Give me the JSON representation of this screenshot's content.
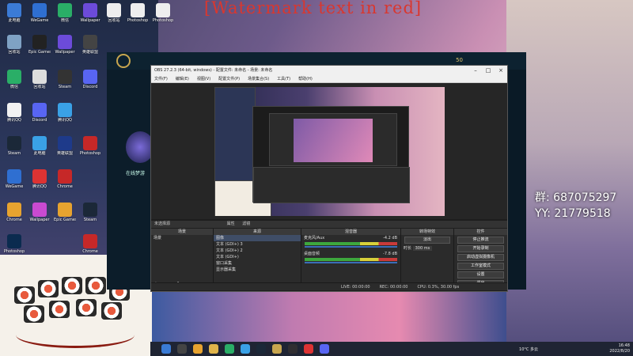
{
  "overlay": {
    "title": "[Watermark text in red]",
    "qq_group": "群: 687075297",
    "yy": "YY: 21779518"
  },
  "desktop_icons": [
    {
      "label": "此电脑",
      "color": "#3b7bd6"
    },
    {
      "label": "WeGame",
      "color": "#2f6fd1"
    },
    {
      "label": "微信",
      "color": "#2aae67"
    },
    {
      "label": "Wallpaper",
      "color": "#6c4bd9"
    },
    {
      "label": "回收站",
      "color": "#7fa2c4"
    },
    {
      "label": "腾讯QQ",
      "color": "#f2f2f2"
    },
    {
      "label": "Steam",
      "color": "#1b2838"
    },
    {
      "label": "Discord",
      "color": "#5865f2"
    },
    {
      "label": "Epic Games",
      "color": "#222222"
    },
    {
      "label": "英雄联盟",
      "color": "#c8a64f"
    },
    {
      "label": "Photoshop",
      "color": "#0b2b4f"
    },
    {
      "label": "Chrome",
      "color": "#e7a32f"
    }
  ],
  "lol_client": {
    "coins": "50",
    "side_text": "在线梦游"
  },
  "obs": {
    "window_title": "OBS 27.2.3 (64-bit, windows) - 配置文件: 未命名 - 场景: 未命名",
    "menu": [
      "文件(F)",
      "编辑(E)",
      "视图(V)",
      "配置文件(P)",
      "场景集合(S)",
      "工具(T)",
      "帮助(H)"
    ],
    "win_buttons": [
      "–",
      "□",
      "×"
    ],
    "source_bar_label": "未选择源",
    "source_bar_buttons": [
      "属性",
      "滤镜"
    ],
    "panels": {
      "scenes": {
        "title": "场景",
        "items": [
          "场景"
        ]
      },
      "sources": {
        "title": "来源",
        "items": [
          "图像",
          "文本 (GDI+) 3",
          "文本 (GDI+) 2",
          "文本 (GDI+)",
          "窗口采集",
          "显示器采集"
        ]
      },
      "mixer": {
        "title": "混音器",
        "tracks": [
          {
            "name": "麦克风/Aux",
            "db": "-4.2 dB"
          },
          {
            "name": "桌面音频",
            "db": "-7.8 dB"
          }
        ]
      },
      "transitions": {
        "title": "转场特效",
        "type": "淡出",
        "duration_label": "时长",
        "duration": "300 ms"
      },
      "controls": {
        "title": "控件",
        "buttons": [
          "停止推流",
          "开始录制",
          "启动虚拟摄像机",
          "工作室模式",
          "设置",
          "退出"
        ]
      }
    },
    "status": {
      "live": "LIVE: 00:00:00",
      "rec": "REC: 00:00:00",
      "cpu": "CPU: 0.3%, 30.00 fps"
    }
  },
  "taskbar": {
    "weather": "10°C 多云",
    "time": "16:48",
    "date": "2022/8/20"
  }
}
